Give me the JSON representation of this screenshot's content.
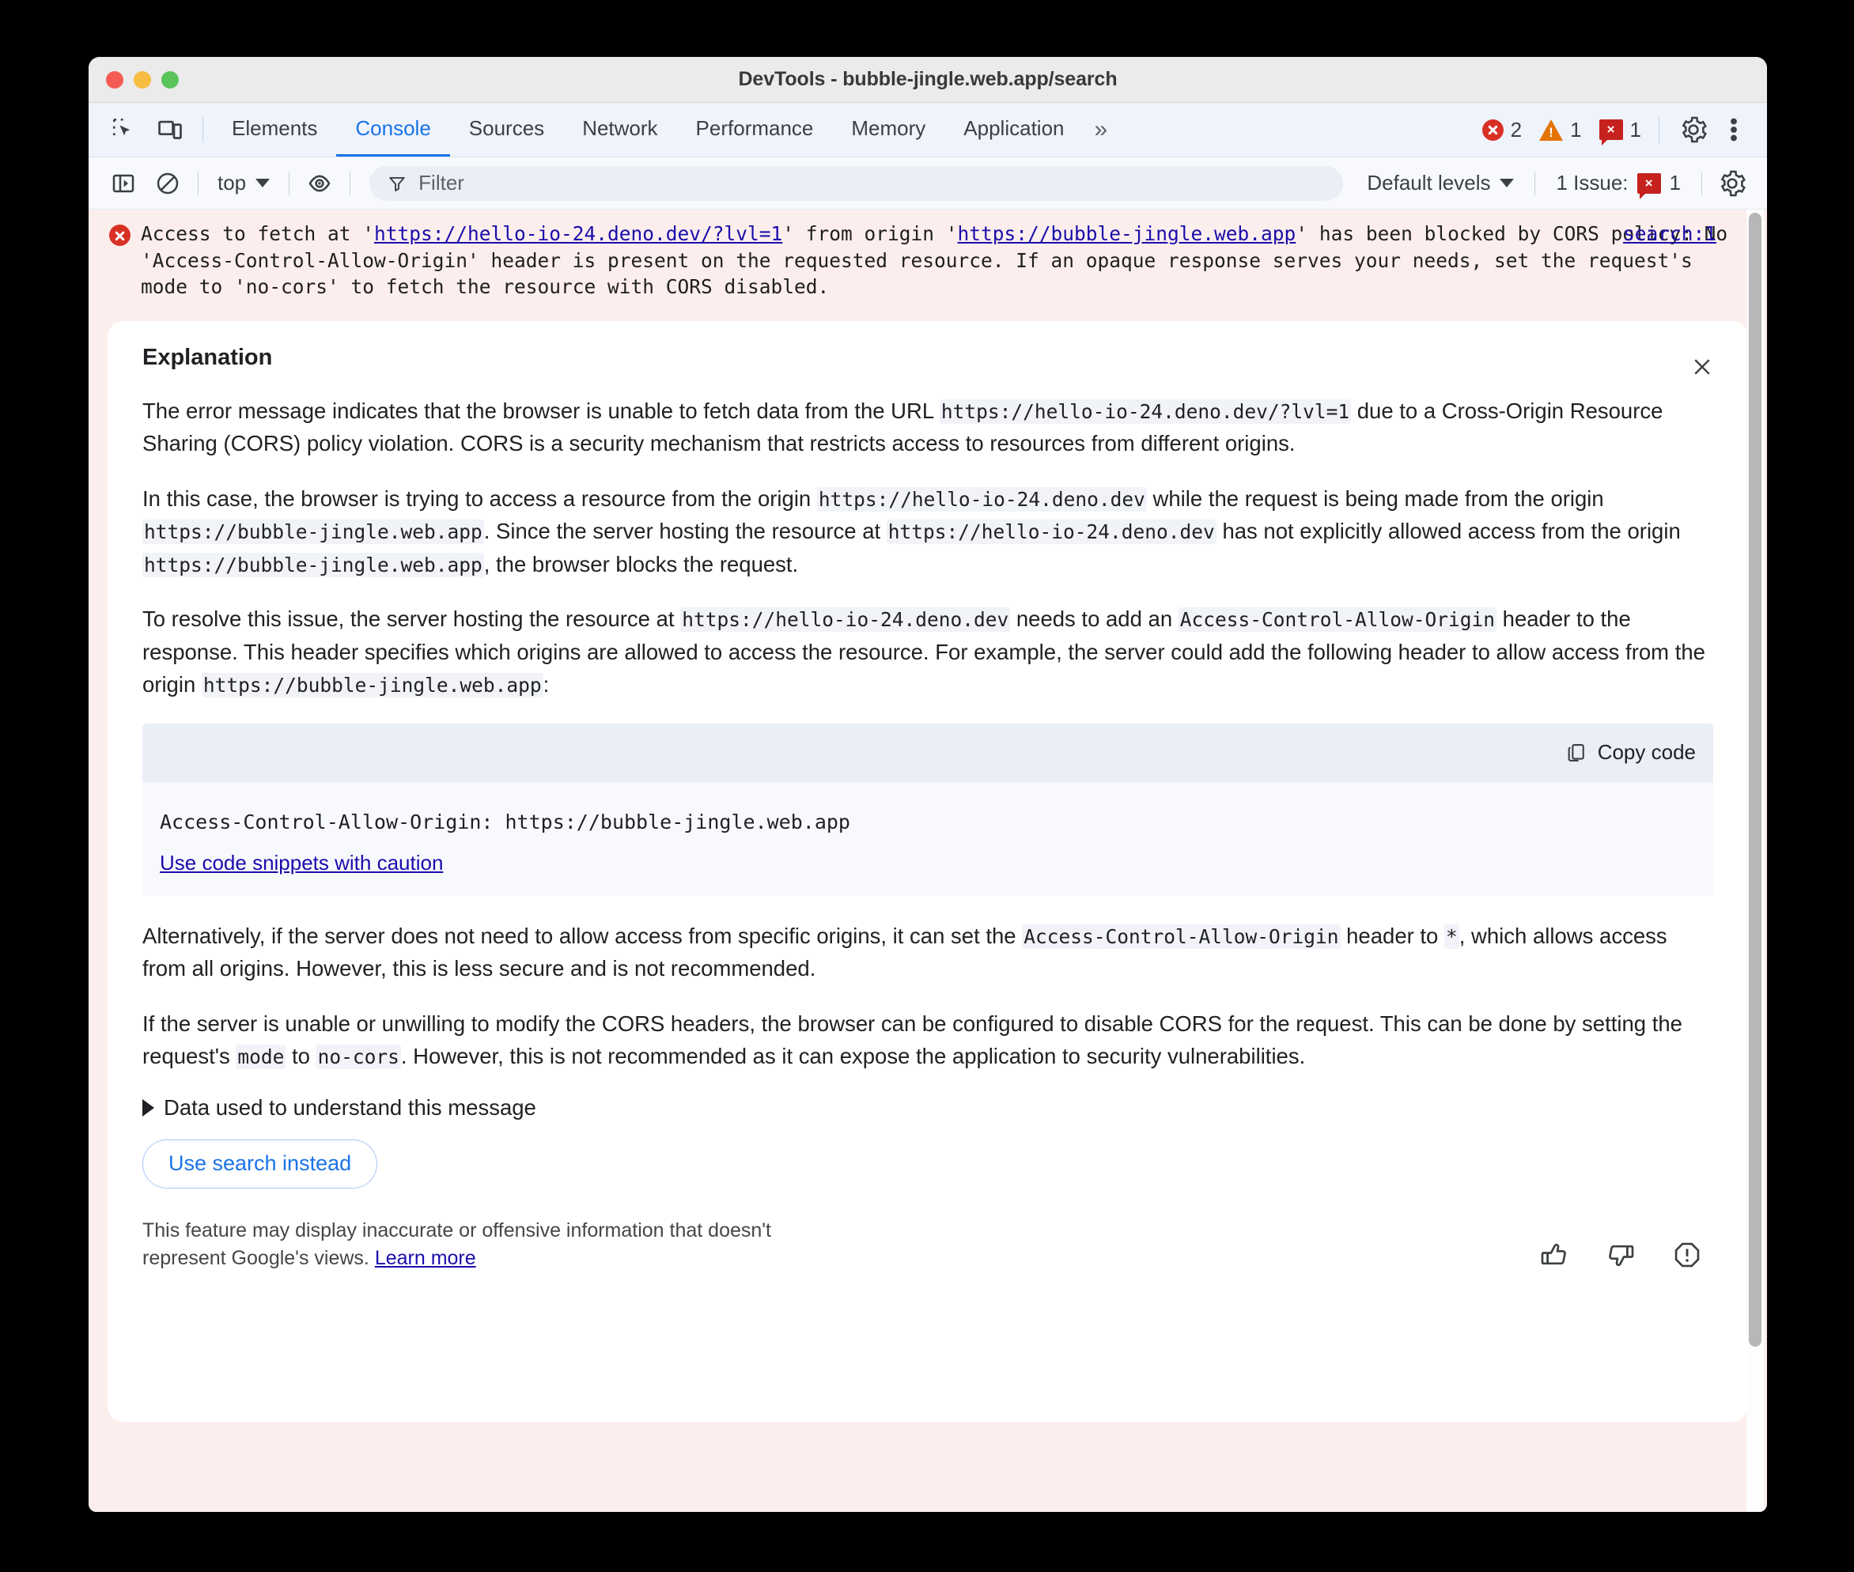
{
  "window": {
    "title": "DevTools - bubble-jingle.web.app/search",
    "traffic_lights": [
      "close-red",
      "minimize-yellow",
      "maximize-green"
    ]
  },
  "tabstrip": {
    "icons": [
      "inspect-element-icon",
      "device-toolbar-icon"
    ],
    "tabs": [
      {
        "label": "Elements",
        "active": false
      },
      {
        "label": "Console",
        "active": true
      },
      {
        "label": "Sources",
        "active": false
      },
      {
        "label": "Network",
        "active": false
      },
      {
        "label": "Performance",
        "active": false
      },
      {
        "label": "Memory",
        "active": false
      },
      {
        "label": "Application",
        "active": false
      }
    ],
    "more_tabs": "»",
    "counters": [
      {
        "icon": "error-badge-icon",
        "count": "2"
      },
      {
        "icon": "warning-badge-icon",
        "count": "1"
      },
      {
        "icon": "issue-badge-icon",
        "count": "1",
        "glyph": "×"
      }
    ],
    "settings_icon": "gear-icon",
    "more_options_icon": "kebab-menu-icon"
  },
  "filterbar": {
    "sidebar_toggle_icon": "show-console-sidebar-icon",
    "clear_icon": "clear-console-icon",
    "context": "top",
    "eye_icon": "live-expression-icon",
    "filter": {
      "icon": "filter-funnel-icon",
      "placeholder": "Filter",
      "value": ""
    },
    "levels": "Default levels",
    "issues_label": "1 Issue:",
    "issues_count": "1",
    "issues_glyph": "×",
    "settings_icon": "console-settings-gear-icon"
  },
  "console_message": {
    "icon": "error-circle-icon",
    "source_link": "search:1",
    "segments": [
      {
        "t": "Access to fetch at '",
        "k": "text"
      },
      {
        "t": "https://hello-io-24.deno.dev/?lvl=1",
        "k": "link"
      },
      {
        "t": "' from origin '",
        "k": "text"
      },
      {
        "t": "https://bubble-jingle.web.app",
        "k": "link"
      },
      {
        "t": "' has been blocked by CORS policy: No 'Access-Control-Allow-Origin' header is present on the requested resource. If an opaque response serves your needs, set the request's mode to 'no-cors' to fetch the resource with CORS disabled.",
        "k": "text"
      }
    ]
  },
  "explanation": {
    "title": "Explanation",
    "close_icon": "close-x-icon",
    "paragraphs": [
      [
        {
          "t": "The error message indicates that the browser is unable to fetch data from the URL ",
          "k": "text"
        },
        {
          "t": "https://hello-io-24.deno.dev/?lvl=1",
          "k": "code"
        },
        {
          "t": " due to a Cross-Origin Resource Sharing (CORS) policy violation. CORS is a security mechanism that restricts access to resources from different origins.",
          "k": "text"
        }
      ],
      [
        {
          "t": "In this case, the browser is trying to access a resource from the origin ",
          "k": "text"
        },
        {
          "t": "https://hello-io-24.deno.dev",
          "k": "code"
        },
        {
          "t": " while the request is being made from the origin ",
          "k": "text"
        },
        {
          "t": "https://bubble-jingle.web.app",
          "k": "code"
        },
        {
          "t": ". Since the server hosting the resource at ",
          "k": "text"
        },
        {
          "t": "https://hello-io-24.deno.dev",
          "k": "code"
        },
        {
          "t": " has not explicitly allowed access from the origin ",
          "k": "text"
        },
        {
          "t": "https://bubble-jingle.web.app",
          "k": "code"
        },
        {
          "t": ", the browser blocks the request.",
          "k": "text"
        }
      ],
      [
        {
          "t": "To resolve this issue, the server hosting the resource at ",
          "k": "text"
        },
        {
          "t": "https://hello-io-24.deno.dev",
          "k": "code"
        },
        {
          "t": " needs to add an ",
          "k": "text"
        },
        {
          "t": "Access-Control-Allow-Origin",
          "k": "code"
        },
        {
          "t": " header to the response. This header specifies which origins are allowed to access the resource. For example, the server could add the following header to allow access from the origin ",
          "k": "text"
        },
        {
          "t": "https://bubble-jingle.web.app",
          "k": "code"
        },
        {
          "t": ":",
          "k": "text"
        }
      ]
    ],
    "codeblock": {
      "copy_label": "Copy code",
      "copy_icon": "copy-icon",
      "code": "Access-Control-Allow-Origin: https://bubble-jingle.web.app",
      "caution_link": "Use code snippets with caution"
    },
    "paragraphs_after": [
      [
        {
          "t": "Alternatively, if the server does not need to allow access from specific origins, it can set the ",
          "k": "text"
        },
        {
          "t": "Access-Control-Allow-Origin",
          "k": "code"
        },
        {
          "t": " header to ",
          "k": "text"
        },
        {
          "t": "*",
          "k": "code"
        },
        {
          "t": ", which allows access from all origins. However, this is less secure and is not recommended.",
          "k": "text"
        }
      ],
      [
        {
          "t": "If the server is unable or unwilling to modify the CORS headers, the browser can be configured to disable CORS for the request. This can be done by setting the request's ",
          "k": "text"
        },
        {
          "t": "mode",
          "k": "code"
        },
        {
          "t": " to ",
          "k": "text"
        },
        {
          "t": "no-cors",
          "k": "code"
        },
        {
          "t": ". However, this is not recommended as it can expose the application to security vulnerabilities.",
          "k": "text"
        }
      ]
    ],
    "disclosure_label": "Data used to understand this message",
    "disclosure_icon": "triangle-right-icon",
    "use_search_button": "Use search instead",
    "disclaimer_text": "This feature may display inaccurate or offensive information that doesn't represent Google's views. ",
    "disclaimer_link": "Learn more",
    "actions": [
      {
        "icon": "thumb-up-icon",
        "name": "rate-positive"
      },
      {
        "icon": "thumb-down-icon",
        "name": "rate-negative"
      },
      {
        "icon": "report-icon",
        "name": "report-content"
      }
    ]
  },
  "colors": {
    "accent": "#1a73e8",
    "error": "#d93025",
    "warning": "#e37400",
    "issue": "#c5221f",
    "link": "#1a0dab",
    "console_error_bg": "#fceeed"
  }
}
